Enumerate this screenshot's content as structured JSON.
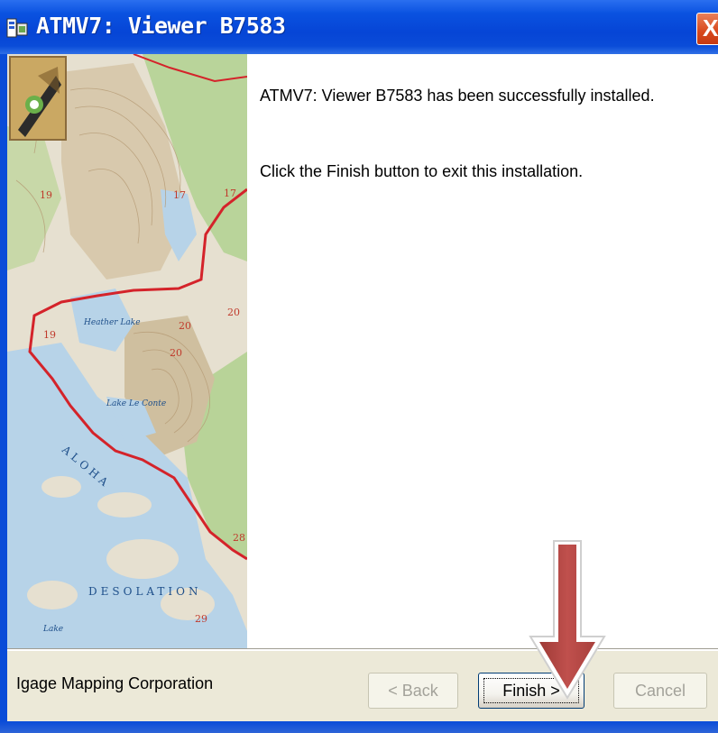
{
  "window": {
    "title": "ATMV7: Viewer  B7583",
    "close_glyph": "X",
    "icon": "installer-icon"
  },
  "content": {
    "message_installed": "ATMV7: Viewer  B7583 has been successfully installed.",
    "message_finish": "Click the Finish button to exit this installation."
  },
  "map": {
    "labels": [
      "17",
      "17",
      "19",
      "19",
      "20",
      "20",
      "20",
      "28",
      "29",
      "Heather Lake",
      "Lake Le Conte",
      "ALOHA",
      "DESOLATION",
      "Lake"
    ]
  },
  "footer": {
    "company": "Igage Mapping Corporation",
    "back_label": "< Back",
    "finish_label": "Finish >",
    "cancel_label": "Cancel"
  },
  "colors": {
    "titlebar": "#0a4cd8",
    "trail": "#d4232a",
    "arrow": "#c0504d",
    "dialog_bg": "#ece9d8"
  }
}
